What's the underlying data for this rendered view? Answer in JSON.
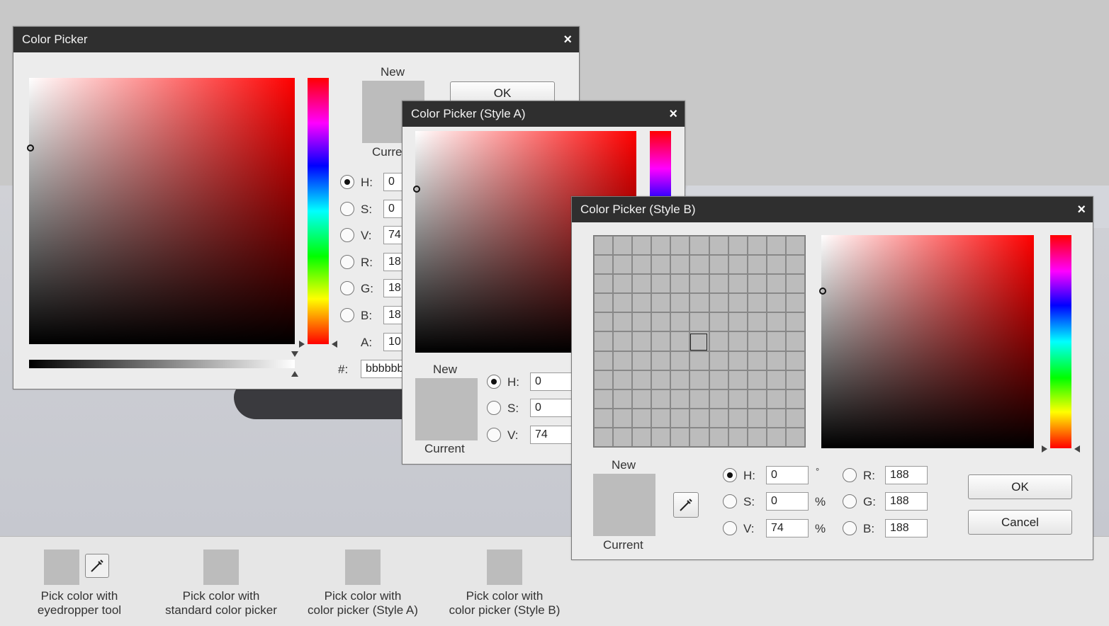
{
  "window_main": {
    "title": "Color Picker",
    "close": "×",
    "new_label": "New",
    "current_label": "Curre",
    "ok_label": "OK",
    "fields": [
      {
        "label": "H:",
        "value": "0",
        "selected": true
      },
      {
        "label": "S:",
        "value": "0",
        "selected": false
      },
      {
        "label": "V:",
        "value": "74",
        "selected": false
      },
      {
        "label": "R:",
        "value": "18",
        "selected": false
      },
      {
        "label": "G:",
        "value": "18",
        "selected": false
      },
      {
        "label": "B:",
        "value": "18",
        "selected": false
      }
    ],
    "alpha_label": "A:",
    "alpha_value": "10",
    "hex_label": "#:",
    "hex_value": "bbbbbb"
  },
  "window_a": {
    "title": "Color Picker (Style A)",
    "close": "×",
    "new_label": "New",
    "current_label": "Current",
    "fields": [
      {
        "label": "H:",
        "value": "0",
        "selected": true
      },
      {
        "label": "S:",
        "value": "0",
        "selected": false
      },
      {
        "label": "V:",
        "value": "74",
        "selected": false
      }
    ]
  },
  "window_b": {
    "title": "Color Picker (Style B)",
    "close": "×",
    "new_label": "New",
    "current_label": "Current",
    "hsv": [
      {
        "label": "H:",
        "value": "0",
        "unit": "°",
        "selected": true
      },
      {
        "label": "S:",
        "value": "0",
        "unit": "%",
        "selected": false
      },
      {
        "label": "V:",
        "value": "74",
        "unit": "%",
        "selected": false
      }
    ],
    "rgb": [
      {
        "label": "R:",
        "value": "188",
        "selected": false
      },
      {
        "label": "G:",
        "value": "188",
        "selected": false
      },
      {
        "label": "B:",
        "value": "188",
        "selected": false
      }
    ],
    "ok_label": "OK",
    "cancel_label": "Cancel"
  },
  "bottom": {
    "items": [
      {
        "label_line1": "Pick color with",
        "label_line2": "eyedropper tool"
      },
      {
        "label_line1": "Pick color with",
        "label_line2": "standard color picker"
      },
      {
        "label_line1": "Pick color with",
        "label_line2": "color picker (Style A)"
      },
      {
        "label_line1": "Pick color with",
        "label_line2": "color picker (Style B)"
      }
    ]
  },
  "colors": {
    "selected_color": "#bcbcbc",
    "titlebar": "#2f2f2f"
  }
}
